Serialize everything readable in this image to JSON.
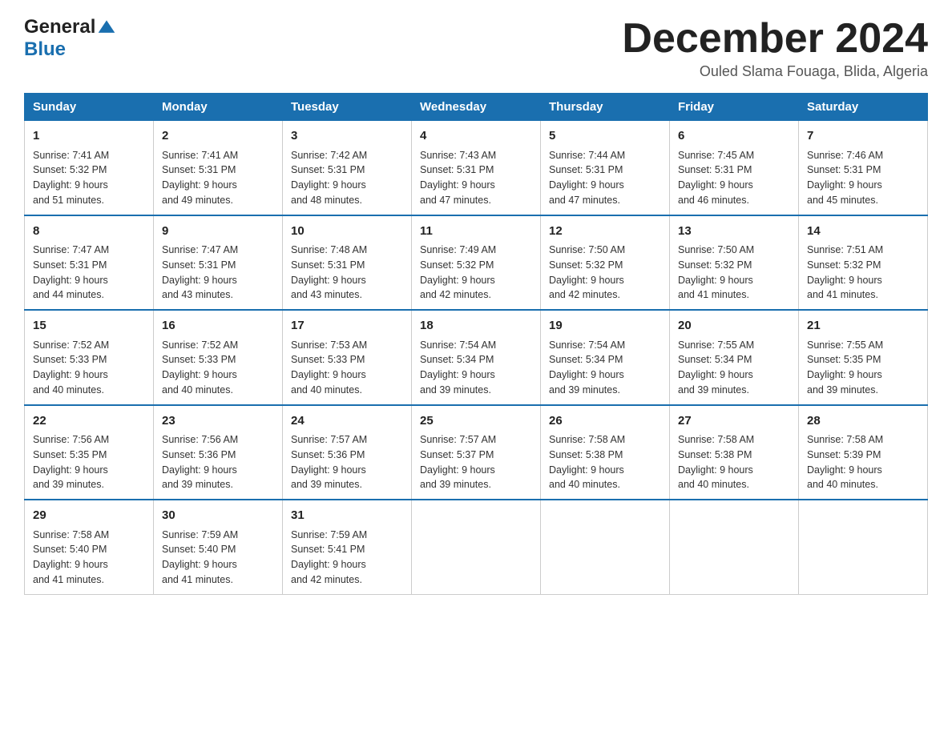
{
  "header": {
    "logo_general": "General",
    "logo_blue": "Blue",
    "month_year": "December 2024",
    "location": "Ouled Slama Fouaga, Blida, Algeria"
  },
  "days_of_week": [
    "Sunday",
    "Monday",
    "Tuesday",
    "Wednesday",
    "Thursday",
    "Friday",
    "Saturday"
  ],
  "weeks": [
    [
      {
        "day": "1",
        "sunrise": "7:41 AM",
        "sunset": "5:32 PM",
        "daylight": "9 hours and 51 minutes."
      },
      {
        "day": "2",
        "sunrise": "7:41 AM",
        "sunset": "5:31 PM",
        "daylight": "9 hours and 49 minutes."
      },
      {
        "day": "3",
        "sunrise": "7:42 AM",
        "sunset": "5:31 PM",
        "daylight": "9 hours and 48 minutes."
      },
      {
        "day": "4",
        "sunrise": "7:43 AM",
        "sunset": "5:31 PM",
        "daylight": "9 hours and 47 minutes."
      },
      {
        "day": "5",
        "sunrise": "7:44 AM",
        "sunset": "5:31 PM",
        "daylight": "9 hours and 47 minutes."
      },
      {
        "day": "6",
        "sunrise": "7:45 AM",
        "sunset": "5:31 PM",
        "daylight": "9 hours and 46 minutes."
      },
      {
        "day": "7",
        "sunrise": "7:46 AM",
        "sunset": "5:31 PM",
        "daylight": "9 hours and 45 minutes."
      }
    ],
    [
      {
        "day": "8",
        "sunrise": "7:47 AM",
        "sunset": "5:31 PM",
        "daylight": "9 hours and 44 minutes."
      },
      {
        "day": "9",
        "sunrise": "7:47 AM",
        "sunset": "5:31 PM",
        "daylight": "9 hours and 43 minutes."
      },
      {
        "day": "10",
        "sunrise": "7:48 AM",
        "sunset": "5:31 PM",
        "daylight": "9 hours and 43 minutes."
      },
      {
        "day": "11",
        "sunrise": "7:49 AM",
        "sunset": "5:32 PM",
        "daylight": "9 hours and 42 minutes."
      },
      {
        "day": "12",
        "sunrise": "7:50 AM",
        "sunset": "5:32 PM",
        "daylight": "9 hours and 42 minutes."
      },
      {
        "day": "13",
        "sunrise": "7:50 AM",
        "sunset": "5:32 PM",
        "daylight": "9 hours and 41 minutes."
      },
      {
        "day": "14",
        "sunrise": "7:51 AM",
        "sunset": "5:32 PM",
        "daylight": "9 hours and 41 minutes."
      }
    ],
    [
      {
        "day": "15",
        "sunrise": "7:52 AM",
        "sunset": "5:33 PM",
        "daylight": "9 hours and 40 minutes."
      },
      {
        "day": "16",
        "sunrise": "7:52 AM",
        "sunset": "5:33 PM",
        "daylight": "9 hours and 40 minutes."
      },
      {
        "day": "17",
        "sunrise": "7:53 AM",
        "sunset": "5:33 PM",
        "daylight": "9 hours and 40 minutes."
      },
      {
        "day": "18",
        "sunrise": "7:54 AM",
        "sunset": "5:34 PM",
        "daylight": "9 hours and 39 minutes."
      },
      {
        "day": "19",
        "sunrise": "7:54 AM",
        "sunset": "5:34 PM",
        "daylight": "9 hours and 39 minutes."
      },
      {
        "day": "20",
        "sunrise": "7:55 AM",
        "sunset": "5:34 PM",
        "daylight": "9 hours and 39 minutes."
      },
      {
        "day": "21",
        "sunrise": "7:55 AM",
        "sunset": "5:35 PM",
        "daylight": "9 hours and 39 minutes."
      }
    ],
    [
      {
        "day": "22",
        "sunrise": "7:56 AM",
        "sunset": "5:35 PM",
        "daylight": "9 hours and 39 minutes."
      },
      {
        "day": "23",
        "sunrise": "7:56 AM",
        "sunset": "5:36 PM",
        "daylight": "9 hours and 39 minutes."
      },
      {
        "day": "24",
        "sunrise": "7:57 AM",
        "sunset": "5:36 PM",
        "daylight": "9 hours and 39 minutes."
      },
      {
        "day": "25",
        "sunrise": "7:57 AM",
        "sunset": "5:37 PM",
        "daylight": "9 hours and 39 minutes."
      },
      {
        "day": "26",
        "sunrise": "7:58 AM",
        "sunset": "5:38 PM",
        "daylight": "9 hours and 40 minutes."
      },
      {
        "day": "27",
        "sunrise": "7:58 AM",
        "sunset": "5:38 PM",
        "daylight": "9 hours and 40 minutes."
      },
      {
        "day": "28",
        "sunrise": "7:58 AM",
        "sunset": "5:39 PM",
        "daylight": "9 hours and 40 minutes."
      }
    ],
    [
      {
        "day": "29",
        "sunrise": "7:58 AM",
        "sunset": "5:40 PM",
        "daylight": "9 hours and 41 minutes."
      },
      {
        "day": "30",
        "sunrise": "7:59 AM",
        "sunset": "5:40 PM",
        "daylight": "9 hours and 41 minutes."
      },
      {
        "day": "31",
        "sunrise": "7:59 AM",
        "sunset": "5:41 PM",
        "daylight": "9 hours and 42 minutes."
      },
      null,
      null,
      null,
      null
    ]
  ],
  "labels": {
    "sunrise": "Sunrise:",
    "sunset": "Sunset:",
    "daylight": "Daylight:"
  }
}
